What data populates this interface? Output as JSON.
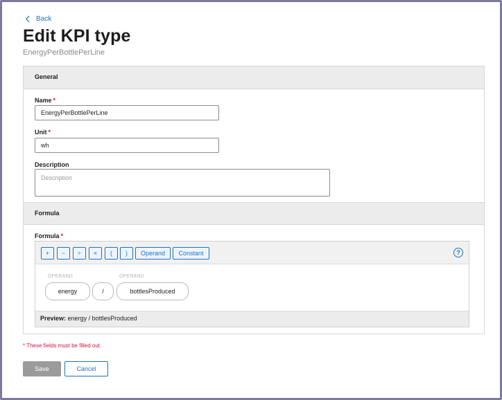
{
  "nav": {
    "back_label": "Back"
  },
  "header": {
    "title": "Edit KPI type",
    "subtitle": "EnergyPerBottlePerLine"
  },
  "general": {
    "section_title": "General",
    "name": {
      "label": "Name",
      "required_mark": "*",
      "value": "EnergyPerBottlePerLine"
    },
    "unit": {
      "label": "Unit",
      "required_mark": "*",
      "value": "wh"
    },
    "description": {
      "label": "Description",
      "placeholder": "Description",
      "value": ""
    }
  },
  "formula": {
    "section_title": "Formula",
    "label": "Formula",
    "required_mark": "*",
    "toolbar": {
      "plus": "+",
      "minus": "−",
      "divide": "÷",
      "multiply": "×",
      "open_paren": "(",
      "close_paren": ")",
      "operand": "Operand",
      "constant": "Constant",
      "help": "?"
    },
    "tokens": {
      "operand1_caption": "OPERAND",
      "operand1_value": "energy",
      "operator": "/",
      "operand2_caption": "OPERAND",
      "operand2_value": "bottlesProduced"
    },
    "preview_label": "Preview:",
    "preview_value": "energy / bottlesProduced"
  },
  "footer": {
    "required_note": "* These fields must be filled out.",
    "save_label": "Save",
    "cancel_label": "Cancel"
  },
  "colors": {
    "accent": "#1a73c1",
    "required": "#d0163b",
    "disabled_button": "#9b9b9b"
  }
}
